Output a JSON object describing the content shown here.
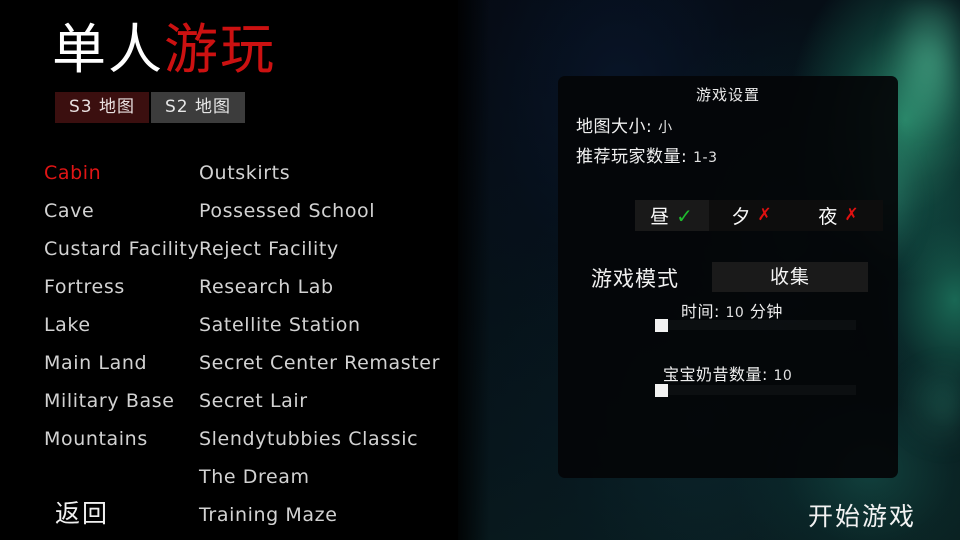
{
  "title": {
    "part_white": "单人",
    "part_red": "游玩",
    "color_white": "#ffffff",
    "color_red": "#cc1111"
  },
  "tabs": [
    {
      "label": "S3 地图",
      "selected": true,
      "bg": "#3b0f0f"
    },
    {
      "label": "S2 地图",
      "selected": false,
      "bg": "#3c3c3c"
    }
  ],
  "maps": {
    "column_left": [
      {
        "label": "Cabin",
        "selected": true
      },
      {
        "label": "Cave",
        "selected": false
      },
      {
        "label": "Custard Facility",
        "selected": false
      },
      {
        "label": "Fortress",
        "selected": false
      },
      {
        "label": "Lake",
        "selected": false
      },
      {
        "label": "Main Land",
        "selected": false
      },
      {
        "label": "Military Base",
        "selected": false
      },
      {
        "label": "Mountains",
        "selected": false
      }
    ],
    "column_right": [
      {
        "label": "Outskirts",
        "selected": false
      },
      {
        "label": "Possessed School",
        "selected": false
      },
      {
        "label": "Reject Facility",
        "selected": false
      },
      {
        "label": "Research Lab",
        "selected": false
      },
      {
        "label": "Satellite Station",
        "selected": false
      },
      {
        "label": "Secret Center Remaster",
        "selected": false
      },
      {
        "label": "Secret Lair",
        "selected": false
      },
      {
        "label": "Slendytubbies Classic",
        "selected": false
      },
      {
        "label": "The Dream",
        "selected": false
      },
      {
        "label": "Training Maze",
        "selected": false
      }
    ],
    "selected_color": "#e01515",
    "normal_color": "#d2d2d2"
  },
  "settings_panel": {
    "title": "游戏设置",
    "map_size_label": "地图大小:",
    "map_size_value": "小",
    "recommended_players_label": "推荐玩家数量:",
    "recommended_players_value": "1-3",
    "time_of_day": [
      {
        "label": "昼",
        "mark": "✓",
        "enabled": true,
        "selected": true,
        "mark_color": "#1fbb2e"
      },
      {
        "label": "夕",
        "mark": "✗",
        "enabled": false,
        "selected": false,
        "mark_color": "#e01010"
      },
      {
        "label": "夜",
        "mark": "✗",
        "enabled": false,
        "selected": false,
        "mark_color": "#e01010"
      }
    ],
    "game_mode_label": "游戏模式",
    "game_mode_value": "收集",
    "sliders": [
      {
        "label": "时间:",
        "value": "10",
        "unit": "分钟",
        "handle_position_pct": 0
      },
      {
        "label": "宝宝奶昔数量:",
        "value": "10",
        "unit": "",
        "handle_position_pct": 0
      }
    ]
  },
  "footer": {
    "back_label": "返回",
    "start_label": "开始游戏"
  }
}
